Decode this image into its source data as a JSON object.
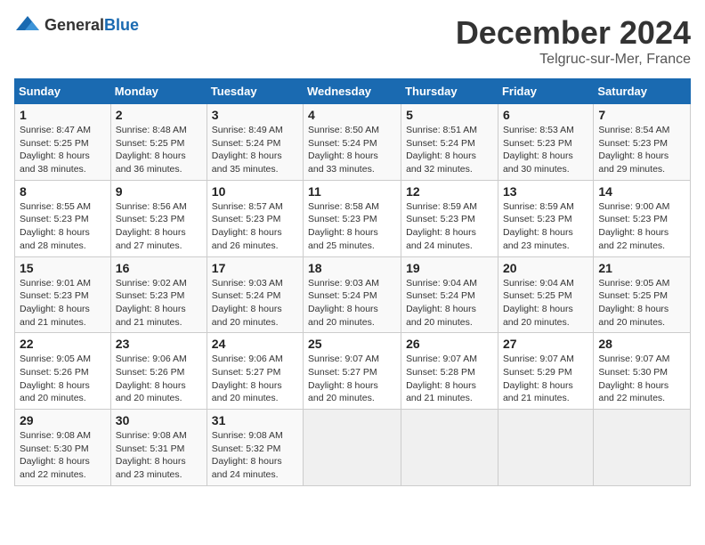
{
  "header": {
    "logo_general": "General",
    "logo_blue": "Blue",
    "month": "December 2024",
    "location": "Telgruc-sur-Mer, France"
  },
  "weekdays": [
    "Sunday",
    "Monday",
    "Tuesday",
    "Wednesday",
    "Thursday",
    "Friday",
    "Saturday"
  ],
  "weeks": [
    [
      {
        "day": "1",
        "info": "Sunrise: 8:47 AM\nSunset: 5:25 PM\nDaylight: 8 hours\nand 38 minutes."
      },
      {
        "day": "2",
        "info": "Sunrise: 8:48 AM\nSunset: 5:25 PM\nDaylight: 8 hours\nand 36 minutes."
      },
      {
        "day": "3",
        "info": "Sunrise: 8:49 AM\nSunset: 5:24 PM\nDaylight: 8 hours\nand 35 minutes."
      },
      {
        "day": "4",
        "info": "Sunrise: 8:50 AM\nSunset: 5:24 PM\nDaylight: 8 hours\nand 33 minutes."
      },
      {
        "day": "5",
        "info": "Sunrise: 8:51 AM\nSunset: 5:24 PM\nDaylight: 8 hours\nand 32 minutes."
      },
      {
        "day": "6",
        "info": "Sunrise: 8:53 AM\nSunset: 5:23 PM\nDaylight: 8 hours\nand 30 minutes."
      },
      {
        "day": "7",
        "info": "Sunrise: 8:54 AM\nSunset: 5:23 PM\nDaylight: 8 hours\nand 29 minutes."
      }
    ],
    [
      {
        "day": "8",
        "info": "Sunrise: 8:55 AM\nSunset: 5:23 PM\nDaylight: 8 hours\nand 28 minutes."
      },
      {
        "day": "9",
        "info": "Sunrise: 8:56 AM\nSunset: 5:23 PM\nDaylight: 8 hours\nand 27 minutes."
      },
      {
        "day": "10",
        "info": "Sunrise: 8:57 AM\nSunset: 5:23 PM\nDaylight: 8 hours\nand 26 minutes."
      },
      {
        "day": "11",
        "info": "Sunrise: 8:58 AM\nSunset: 5:23 PM\nDaylight: 8 hours\nand 25 minutes."
      },
      {
        "day": "12",
        "info": "Sunrise: 8:59 AM\nSunset: 5:23 PM\nDaylight: 8 hours\nand 24 minutes."
      },
      {
        "day": "13",
        "info": "Sunrise: 8:59 AM\nSunset: 5:23 PM\nDaylight: 8 hours\nand 23 minutes."
      },
      {
        "day": "14",
        "info": "Sunrise: 9:00 AM\nSunset: 5:23 PM\nDaylight: 8 hours\nand 22 minutes."
      }
    ],
    [
      {
        "day": "15",
        "info": "Sunrise: 9:01 AM\nSunset: 5:23 PM\nDaylight: 8 hours\nand 21 minutes."
      },
      {
        "day": "16",
        "info": "Sunrise: 9:02 AM\nSunset: 5:23 PM\nDaylight: 8 hours\nand 21 minutes."
      },
      {
        "day": "17",
        "info": "Sunrise: 9:03 AM\nSunset: 5:24 PM\nDaylight: 8 hours\nand 20 minutes."
      },
      {
        "day": "18",
        "info": "Sunrise: 9:03 AM\nSunset: 5:24 PM\nDaylight: 8 hours\nand 20 minutes."
      },
      {
        "day": "19",
        "info": "Sunrise: 9:04 AM\nSunset: 5:24 PM\nDaylight: 8 hours\nand 20 minutes."
      },
      {
        "day": "20",
        "info": "Sunrise: 9:04 AM\nSunset: 5:25 PM\nDaylight: 8 hours\nand 20 minutes."
      },
      {
        "day": "21",
        "info": "Sunrise: 9:05 AM\nSunset: 5:25 PM\nDaylight: 8 hours\nand 20 minutes."
      }
    ],
    [
      {
        "day": "22",
        "info": "Sunrise: 9:05 AM\nSunset: 5:26 PM\nDaylight: 8 hours\nand 20 minutes."
      },
      {
        "day": "23",
        "info": "Sunrise: 9:06 AM\nSunset: 5:26 PM\nDaylight: 8 hours\nand 20 minutes."
      },
      {
        "day": "24",
        "info": "Sunrise: 9:06 AM\nSunset: 5:27 PM\nDaylight: 8 hours\nand 20 minutes."
      },
      {
        "day": "25",
        "info": "Sunrise: 9:07 AM\nSunset: 5:27 PM\nDaylight: 8 hours\nand 20 minutes."
      },
      {
        "day": "26",
        "info": "Sunrise: 9:07 AM\nSunset: 5:28 PM\nDaylight: 8 hours\nand 21 minutes."
      },
      {
        "day": "27",
        "info": "Sunrise: 9:07 AM\nSunset: 5:29 PM\nDaylight: 8 hours\nand 21 minutes."
      },
      {
        "day": "28",
        "info": "Sunrise: 9:07 AM\nSunset: 5:30 PM\nDaylight: 8 hours\nand 22 minutes."
      }
    ],
    [
      {
        "day": "29",
        "info": "Sunrise: 9:08 AM\nSunset: 5:30 PM\nDaylight: 8 hours\nand 22 minutes."
      },
      {
        "day": "30",
        "info": "Sunrise: 9:08 AM\nSunset: 5:31 PM\nDaylight: 8 hours\nand 23 minutes."
      },
      {
        "day": "31",
        "info": "Sunrise: 9:08 AM\nSunset: 5:32 PM\nDaylight: 8 hours\nand 24 minutes."
      },
      {
        "day": "",
        "info": ""
      },
      {
        "day": "",
        "info": ""
      },
      {
        "day": "",
        "info": ""
      },
      {
        "day": "",
        "info": ""
      }
    ]
  ]
}
